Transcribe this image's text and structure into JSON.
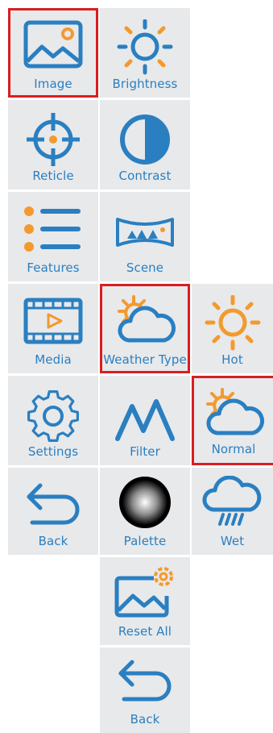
{
  "menu": {
    "col1": [
      {
        "label": "Image",
        "icon": "image-icon",
        "selected": true
      },
      {
        "label": "Reticle",
        "icon": "reticle-icon"
      },
      {
        "label": "Features",
        "icon": "features-list-icon"
      },
      {
        "label": "Media",
        "icon": "media-film-icon"
      },
      {
        "label": "Settings",
        "icon": "gear-icon"
      },
      {
        "label": "Back",
        "icon": "back-arrow-icon"
      }
    ],
    "col2": [
      {
        "label": "Brightness",
        "icon": "sun-icon"
      },
      {
        "label": "Contrast",
        "icon": "contrast-icon"
      },
      {
        "label": "Scene",
        "icon": "scene-panorama-icon"
      },
      {
        "label": "Weather Type",
        "icon": "weather-cloud-sun-icon",
        "selected": true
      },
      {
        "label": "Filter",
        "icon": "filter-peaks-icon"
      },
      {
        "label": "Palette",
        "icon": "palette-sphere-icon"
      },
      {
        "label": "Reset All",
        "icon": "reset-image-gear-icon"
      },
      {
        "label": "Back",
        "icon": "back-arrow-icon"
      }
    ],
    "col3": [
      {
        "label": "Hot",
        "icon": "hot-sun-icon"
      },
      {
        "label": "Normal",
        "icon": "normal-cloud-sun-icon",
        "selected": true
      },
      {
        "label": "Wet",
        "icon": "rain-cloud-icon"
      }
    ]
  },
  "colors": {
    "tile": "#e8e9eb",
    "blue": "#2a7fc1",
    "orange": "#f39a2e",
    "selection": "#d81e22"
  }
}
